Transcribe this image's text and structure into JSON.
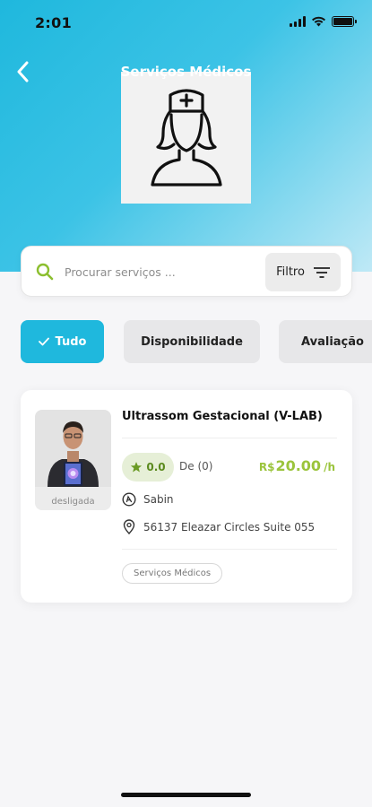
{
  "status_bar": {
    "time": "2:01"
  },
  "header": {
    "title": "Serviços Médicos"
  },
  "search": {
    "placeholder": "Procurar serviços ...",
    "filter_label": "Filtro"
  },
  "chips": [
    {
      "label": "Tudo",
      "active": true
    },
    {
      "label": "Disponibilidade",
      "active": false
    },
    {
      "label": "Avaliação",
      "active": false
    }
  ],
  "service_card": {
    "title": "Ultrassom Gestacional (V-LAB)",
    "photo_status": "desligada",
    "rating": "0.0",
    "rating_count": "De (0)",
    "price_currency": "R$",
    "price_value": "20.00",
    "price_unit": "/h",
    "provider": "Sabin",
    "address": "56137 Eleazar Circles Suite 055",
    "category": "Serviços Médicos"
  },
  "colors": {
    "accent": "#1fb8dd",
    "price": "#9bc43c",
    "search_icon": "#8cbf2f",
    "rating_bg": "#e6efd7"
  }
}
